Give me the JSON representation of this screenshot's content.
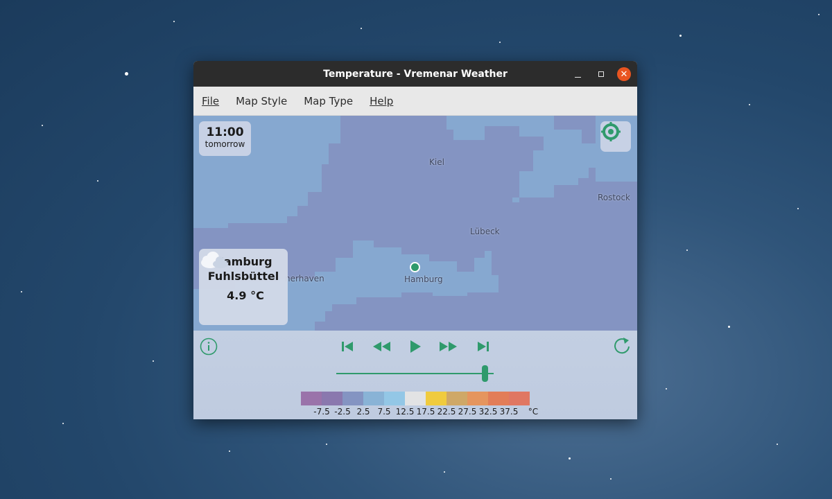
{
  "window": {
    "title": "Temperature - Vremenar Weather",
    "controls": [
      "minimize",
      "maximize",
      "close"
    ]
  },
  "menu": {
    "file": "File",
    "map_style": "Map Style",
    "map_type": "Map Type",
    "help": "Help"
  },
  "map": {
    "time": "11:00",
    "day": "tomorrow",
    "labels": {
      "kiel": "Kiel",
      "rostock": "Rostock",
      "lubeck": "Lübeck",
      "hamburg": "Hamburg",
      "bremerhaven": "nerhaven"
    }
  },
  "station": {
    "name_line1": "Hamburg",
    "name_line2": "Fuhlsbüttel",
    "temperature": "4.9 °C",
    "icon": "cloud-icon"
  },
  "player": {
    "slider_fraction": 0.94,
    "buttons": [
      "info-icon",
      "first-icon",
      "rewind-icon",
      "play-icon",
      "forward-icon",
      "last-icon",
      "refresh-icon"
    ]
  },
  "legend": {
    "unit": "°C",
    "labels": [
      "-7.5",
      "-2.5",
      "2.5",
      "7.5",
      "12.5",
      "17.5",
      "22.5",
      "27.5",
      "32.5",
      "37.5"
    ],
    "colors": [
      "#9a73aa",
      "#8a78ae",
      "#8494c2",
      "#89b3d6",
      "#93c7e6",
      "#e2e3e4",
      "#f0cb3e",
      "#cfa867",
      "#e5955e",
      "#e27d58",
      "#e07762"
    ]
  },
  "colors": {
    "accent": "#2f9a6c",
    "map_cold": "#8494c2",
    "map_cool": "#86a8d0",
    "close_button": "#e95420"
  }
}
